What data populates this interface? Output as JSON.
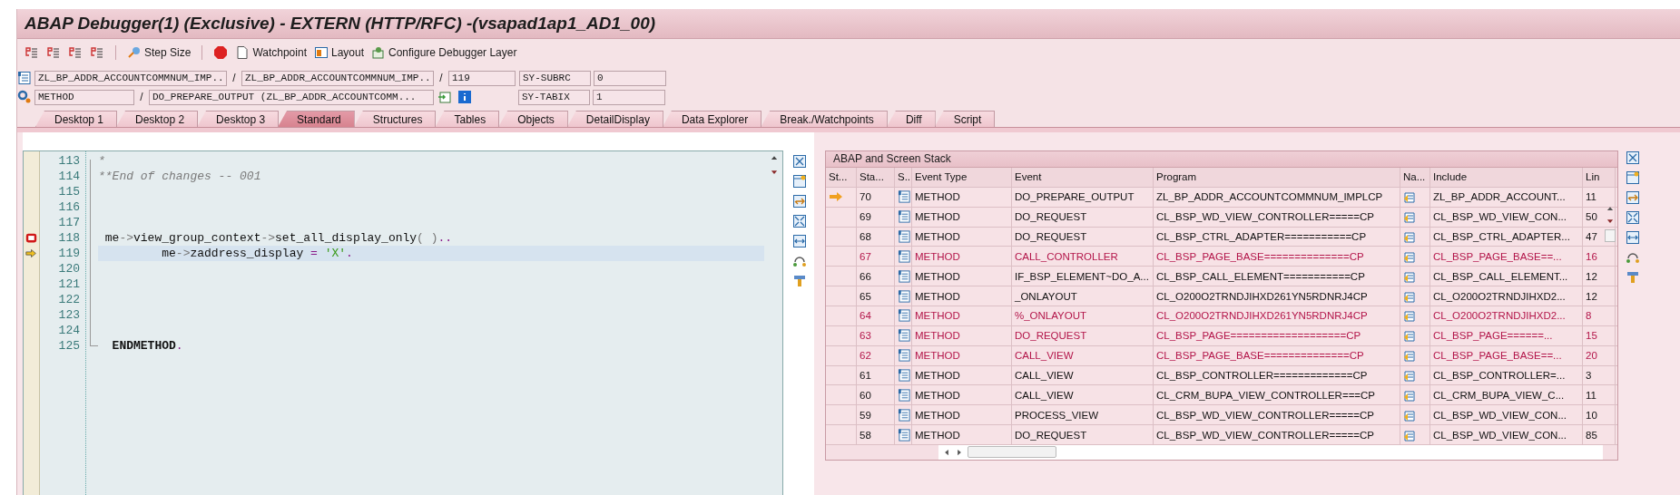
{
  "window": {
    "title": "ABAP Debugger(1)  (Exclusive) - EXTERN (HTTP/RFC) -(vsapad1ap1_AD1_00)"
  },
  "toolbar": [
    {
      "kind": "step",
      "label": "Step Size"
    },
    {
      "kind": "watch",
      "label": "Watchpoint"
    },
    {
      "kind": "layout",
      "label": "Layout"
    },
    {
      "kind": "config",
      "label": "Configure Debugger Layer"
    }
  ],
  "location_rows": [
    {
      "items": [
        {
          "kind": "field",
          "value": "ZL_BP_ADDR_ACCOUNTCOMMNUM_IMP..."
        },
        {
          "kind": "separator",
          "text": "/"
        },
        {
          "kind": "field",
          "value": "ZL_BP_ADDR_ACCOUNTCOMMNUM_IMP..."
        },
        {
          "kind": "separator",
          "text": "/"
        },
        {
          "kind": "field",
          "value": "119"
        }
      ],
      "sys_name": "SY-SUBRC",
      "sys_value": "0"
    },
    {
      "items": [
        {
          "kind": "field",
          "value": "METHOD"
        },
        {
          "kind": "separator",
          "text": "/"
        },
        {
          "kind": "field",
          "value": "DO_PREPARE_OUTPUT (ZL_BP_ADDR_ACCOUNTCOMM..."
        }
      ],
      "sys_name": "SY-TABIX",
      "sys_value": "1"
    }
  ],
  "tabs": [
    {
      "label": "Desktop 1",
      "selected": false
    },
    {
      "label": "Desktop 2",
      "selected": false
    },
    {
      "label": "Desktop 3",
      "selected": false
    },
    {
      "label": "Standard",
      "selected": true
    },
    {
      "label": "Structures",
      "selected": false
    },
    {
      "label": "Tables",
      "selected": false
    },
    {
      "label": "Objects",
      "selected": false
    },
    {
      "label": "DetailDisplay",
      "selected": false
    },
    {
      "label": "Data Explorer",
      "selected": false
    },
    {
      "label": "Break./Watchpoints",
      "selected": false
    },
    {
      "label": "Diff",
      "selected": false
    },
    {
      "label": "Script",
      "selected": false
    }
  ],
  "code_lines": [
    {
      "number": "113",
      "breakpoint": false,
      "current": false,
      "tokens": [
        {
          "text": "*",
          "kind": "comment"
        }
      ]
    },
    {
      "number": "114",
      "breakpoint": false,
      "current": false,
      "tokens": [
        {
          "text": "**End of changes -- 001",
          "kind": "comment"
        }
      ]
    },
    {
      "number": "115",
      "breakpoint": false,
      "current": false
    },
    {
      "number": "116",
      "breakpoint": false,
      "current": false
    },
    {
      "number": "117",
      "breakpoint": false,
      "current": false
    },
    {
      "number": "118",
      "breakpoint": true,
      "current": false,
      "tokens": [
        {
          "text": " me",
          "kind": "plain"
        },
        {
          "text": "->",
          "kind": "op"
        },
        {
          "text": "view_group_context",
          "kind": "plain"
        },
        {
          "text": "->",
          "kind": "op"
        },
        {
          "text": "set_all_display_only",
          "kind": "plain"
        },
        {
          "text": "( )",
          "kind": "op"
        },
        {
          "text": "..",
          "kind": "punct"
        }
      ]
    },
    {
      "number": "119",
      "breakpoint": false,
      "current": true,
      "tokens": [
        {
          "text": "         me",
          "kind": "plain"
        },
        {
          "text": "->",
          "kind": "op"
        },
        {
          "text": "zaddress_display ",
          "kind": "plain"
        },
        {
          "text": "=",
          "kind": "punct"
        },
        {
          "text": " 'X'",
          "kind": "string"
        },
        {
          "text": ".",
          "kind": "punct"
        }
      ]
    },
    {
      "number": "120",
      "breakpoint": false,
      "current": false
    },
    {
      "number": "121",
      "breakpoint": false,
      "current": false
    },
    {
      "number": "122",
      "breakpoint": false,
      "current": false
    },
    {
      "number": "123",
      "breakpoint": false,
      "current": false
    },
    {
      "number": "124",
      "breakpoint": false,
      "current": false
    },
    {
      "number": "125",
      "breakpoint": false,
      "current": false,
      "tokens": [
        {
          "text": "  ENDMETHOD",
          "kind": "keyword"
        },
        {
          "text": ".",
          "kind": "punct"
        }
      ]
    }
  ],
  "stack": {
    "title": "ABAP and Screen Stack",
    "columns": [
      "St...",
      "Sta...",
      "S..",
      "Event Type",
      "Event",
      "Program",
      "Na...",
      "Include",
      "Lin"
    ],
    "rows": [
      {
        "current": true,
        "highlighted": false,
        "level": "70",
        "event_type": "METHOD",
        "event": "DO_PREPARE_OUTPUT",
        "program": "ZL_BP_ADDR_ACCOUNTCOMMNUM_IMPLCP",
        "include": "ZL_BP_ADDR_ACCOUNT...",
        "line": "11"
      },
      {
        "current": false,
        "highlighted": false,
        "level": "69",
        "event_type": "METHOD",
        "event": "DO_REQUEST",
        "program": "CL_BSP_WD_VIEW_CONTROLLER=====CP",
        "include": "CL_BSP_WD_VIEW_CON...",
        "line": "50"
      },
      {
        "current": false,
        "highlighted": false,
        "level": "68",
        "event_type": "METHOD",
        "event": "DO_REQUEST",
        "program": "CL_BSP_CTRL_ADAPTER===========CP",
        "include": "CL_BSP_CTRL_ADAPTER...",
        "line": "47"
      },
      {
        "current": false,
        "highlighted": true,
        "level": "67",
        "event_type": "METHOD",
        "event": "CALL_CONTROLLER",
        "program": "CL_BSP_PAGE_BASE==============CP",
        "include": "CL_BSP_PAGE_BASE==...",
        "line": "16"
      },
      {
        "current": false,
        "highlighted": false,
        "level": "66",
        "event_type": "METHOD",
        "event": "IF_BSP_ELEMENT~DO_A...",
        "program": "CL_BSP_CALL_ELEMENT===========CP",
        "include": "CL_BSP_CALL_ELEMENT...",
        "line": "12"
      },
      {
        "current": false,
        "highlighted": false,
        "level": "65",
        "event_type": "METHOD",
        "event": "_ONLAYOUT",
        "program": "CL_O200O2TRNDJIHXD261YN5RDNRJ4CP",
        "include": "CL_O200O2TRNDJIHXD2...",
        "line": "12"
      },
      {
        "current": false,
        "highlighted": true,
        "level": "64",
        "event_type": "METHOD",
        "event": "%_ONLAYOUT",
        "program": "CL_O200O2TRNDJIHXD261YN5RDNRJ4CP",
        "include": "CL_O200O2TRNDJIHXD2...",
        "line": "8"
      },
      {
        "current": false,
        "highlighted": true,
        "level": "63",
        "event_type": "METHOD",
        "event": "DO_REQUEST",
        "program": "CL_BSP_PAGE===================CP",
        "include": "CL_BSP_PAGE======...",
        "line": "15"
      },
      {
        "current": false,
        "highlighted": true,
        "level": "62",
        "event_type": "METHOD",
        "event": "CALL_VIEW",
        "program": "CL_BSP_PAGE_BASE==============CP",
        "include": "CL_BSP_PAGE_BASE==...",
        "line": "20"
      },
      {
        "current": false,
        "highlighted": false,
        "level": "61",
        "event_type": "METHOD",
        "event": "CALL_VIEW",
        "program": "CL_BSP_CONTROLLER=============CP",
        "include": "CL_BSP_CONTROLLER=...",
        "line": "3"
      },
      {
        "current": false,
        "highlighted": false,
        "level": "60",
        "event_type": "METHOD",
        "event": "CALL_VIEW",
        "program": "CL_CRM_BUPA_VIEW_CONTROLLER===CP",
        "include": "CL_CRM_BUPA_VIEW_C...",
        "line": "11"
      },
      {
        "current": false,
        "highlighted": false,
        "level": "59",
        "event_type": "METHOD",
        "event": "PROCESS_VIEW",
        "program": "CL_BSP_WD_VIEW_CONTROLLER=====CP",
        "include": "CL_BSP_WD_VIEW_CON...",
        "line": "10"
      },
      {
        "current": false,
        "highlighted": false,
        "level": "58",
        "event_type": "METHOD",
        "event": "DO_REQUEST",
        "program": "CL_BSP_WD_VIEW_CONTROLLER=====CP",
        "include": "CL_BSP_WD_VIEW_CON...",
        "line": "85"
      }
    ]
  }
}
